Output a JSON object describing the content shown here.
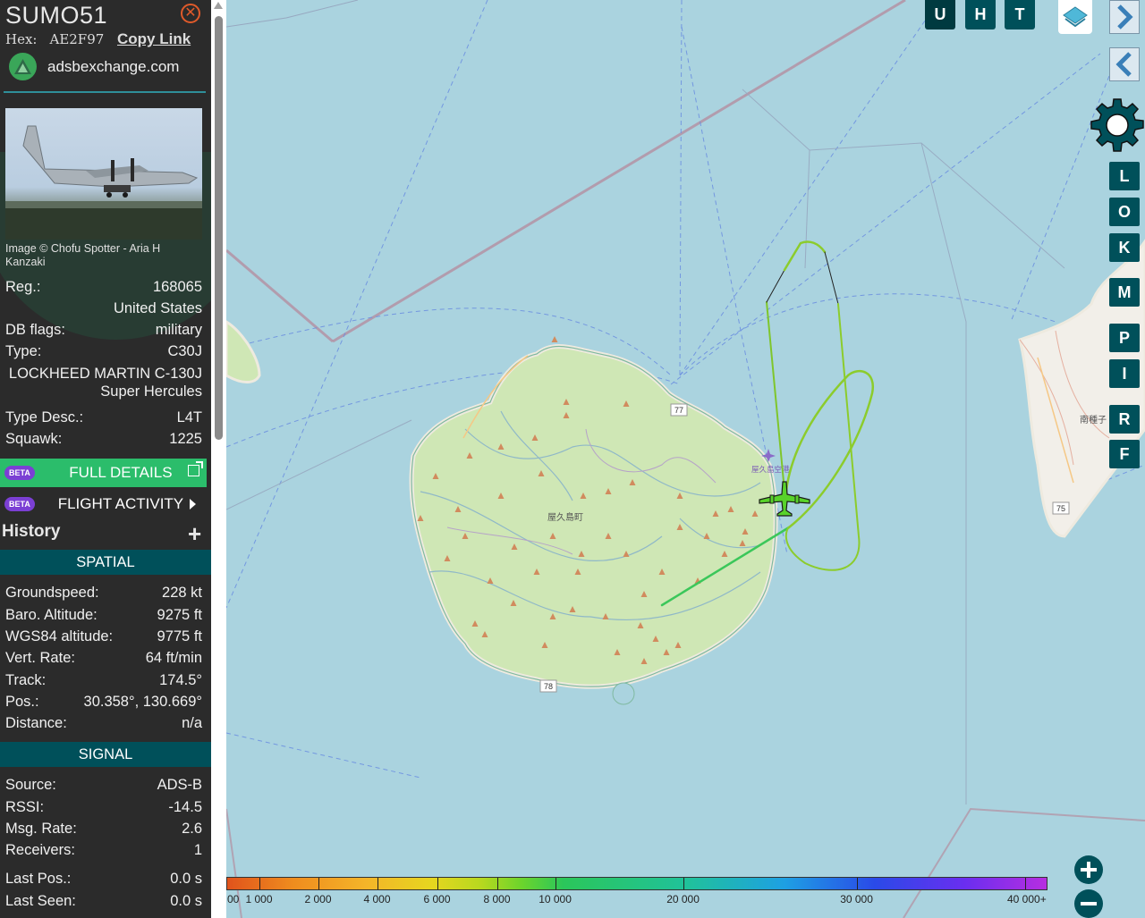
{
  "aircraft": {
    "callsign": "SUMO51",
    "hex_label": "Hex:",
    "hex": "AE2F97",
    "copy_link": "Copy Link",
    "site": "adsbexchange.com",
    "photo_credit": "Image © Chofu Spotter - Aria H Kanzaki",
    "reg_label": "Reg.:",
    "reg": "168065",
    "country": "United States",
    "dbflags_label": "DB flags:",
    "dbflags": "military",
    "type_label": "Type:",
    "type": "C30J",
    "type_name": "LOCKHEED MARTIN C-130J Super Hercules",
    "typedesc_label": "Type Desc.:",
    "typedesc": "L4T",
    "squawk_label": "Squawk:",
    "squawk": "1225"
  },
  "buttons": {
    "beta": "BETA",
    "full_details": "FULL DETAILS",
    "flight_activity": "FLIGHT ACTIVITY",
    "history": "History",
    "history_plus": "+"
  },
  "spatial": {
    "title": "SPATIAL",
    "rows": [
      {
        "label": "Groundspeed:",
        "value": "228 kt"
      },
      {
        "label": "Baro. Altitude:",
        "value": "9275 ft"
      },
      {
        "label": "WGS84 altitude:",
        "value": "9775 ft"
      },
      {
        "label": "Vert. Rate:",
        "value": "64 ft/min"
      },
      {
        "label": "Track:",
        "value": "174.5°"
      },
      {
        "label": "Pos.:",
        "value": "30.358°, 130.669°"
      },
      {
        "label": "Distance:",
        "value": "n/a"
      }
    ]
  },
  "signal": {
    "title": "SIGNAL",
    "rows": [
      {
        "label": "Source:",
        "value": "ADS-B"
      },
      {
        "label": "RSSI:",
        "value": "-14.5"
      },
      {
        "label": "Msg. Rate:",
        "value": "2.6"
      },
      {
        "label": "Receivers:",
        "value": "1"
      },
      {
        "label": "Last Pos.:",
        "value": "0.0 s"
      },
      {
        "label": "Last Seen:",
        "value": "0.0 s"
      }
    ]
  },
  "map": {
    "top_buttons": [
      "U",
      "H",
      "T"
    ],
    "side_buttons": [
      "L",
      "O",
      "K",
      "M",
      "P",
      "I",
      "R",
      "F"
    ],
    "road_labels": [
      "77",
      "78",
      "75"
    ],
    "town_label": "屋久島町",
    "airport_label": "屋久島空港",
    "east_town_label": "南種子",
    "colors": {
      "sea": "#aad3df",
      "land": "#cfe7b5",
      "track": "#8ccc2c",
      "aircraft": "#58d22a"
    }
  },
  "altitude_legend": {
    "labels": [
      "00",
      "1 000",
      "2 000",
      "4 000",
      "6 000",
      "8 000",
      "10 000",
      "20 000",
      "30 000",
      "40 000+"
    ]
  }
}
